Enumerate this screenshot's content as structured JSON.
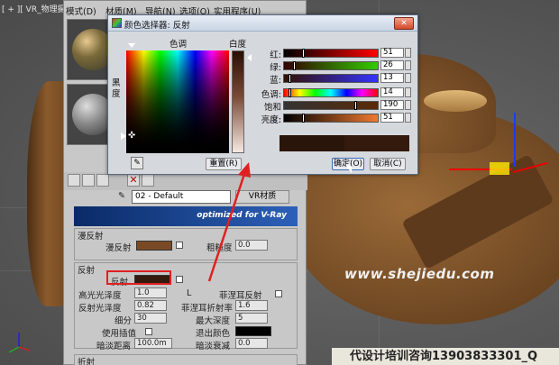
{
  "viewport": {
    "label": "[ + ][ VR_物理摄",
    "watermark": "www.shejiedu.com",
    "promo": "代设计培训咨询13903833301_Q"
  },
  "material_editor": {
    "menu": [
      "模式(D)",
      "材质(M)",
      "导航(N)",
      "选项(O)",
      "实用程序(U)"
    ],
    "material_name": "02 - Default",
    "material_type": "VR材质",
    "vray_banner": "optimized for V-Ray",
    "diffuse": {
      "section": "漫反射",
      "diffuse_label": "漫反射",
      "roughness_label": "粗糙度",
      "roughness_value": "0.0"
    },
    "reflection": {
      "section": "反射",
      "reflect_label": "反射",
      "hilight_gloss_label": "高光光泽度",
      "hilight_gloss_value": "1.0",
      "lock_label": "L",
      "fresnel_label": "菲涅耳反射",
      "refl_gloss_label": "反射光泽度",
      "refl_gloss_value": "0.82",
      "fresnel_ior_label": "菲涅耳折射率",
      "fresnel_ior_value": "1.6",
      "subdivs_label": "细分",
      "subdivs_value": "30",
      "max_depth_label": "最大深度",
      "max_depth_value": "5",
      "use_interp_label": "使用插值",
      "exit_color_label": "退出颜色",
      "dim_distance_label": "暗淡距离",
      "dim_distance_value": "100.0m",
      "dim_falloff_label": "暗淡衰减",
      "dim_falloff_value": "0.0"
    },
    "refraction": {
      "section": "折射"
    }
  },
  "color_dialog": {
    "title": "颜色选择器: 反射",
    "close_glyph": "✕",
    "hue_label": "色调",
    "whiteness_label": "白度",
    "blackness_label": "黑度",
    "reset_label": "重置(R)",
    "ok_label": "确定(O)",
    "cancel_label": "取消(C)",
    "sliders": [
      {
        "label": "红:",
        "value": "51"
      },
      {
        "label": "绿:",
        "value": "26"
      },
      {
        "label": "蓝:",
        "value": "13"
      },
      {
        "label": "色调:",
        "value": "14"
      },
      {
        "label": "饱和度:",
        "value": "190"
      },
      {
        "label": "亮度:",
        "value": "51"
      }
    ],
    "colors": {
      "current": "#331a0d",
      "previous": "#2a150a"
    }
  }
}
